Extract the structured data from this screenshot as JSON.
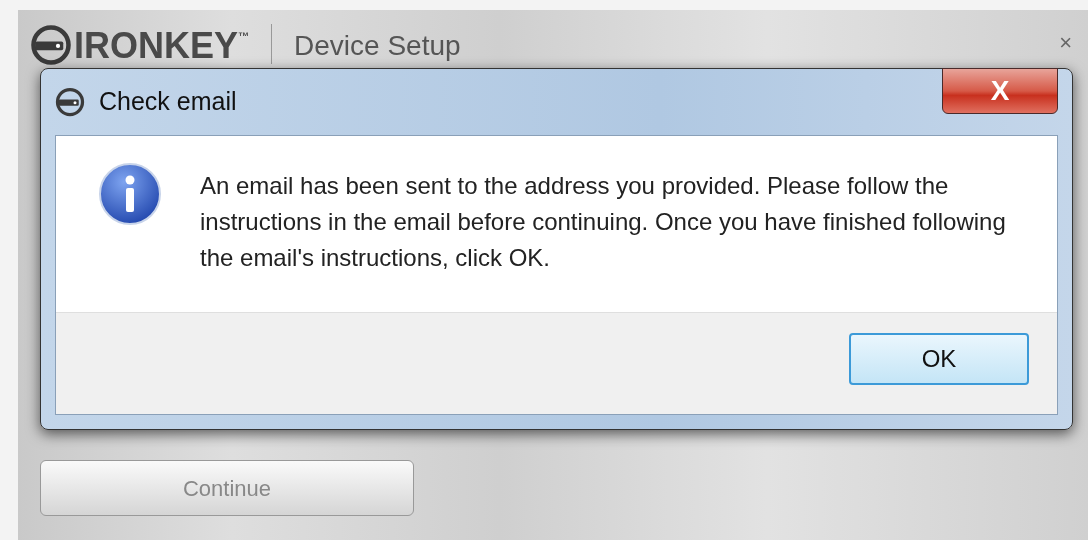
{
  "app_window": {
    "logo": "IRONKEY",
    "trademark": "™",
    "title": "Device Setup",
    "close": "×",
    "continue_button": {
      "label": "Continue",
      "disabled": true
    }
  },
  "dialog": {
    "title": "Check email",
    "close": "X",
    "message": "An email has been sent to the address you provided. Please follow the instructions in the email before continuing. Once you have finished following the email's instructions, click OK.",
    "buttons": [
      {
        "label": "OK",
        "selected": true
      }
    ]
  }
}
